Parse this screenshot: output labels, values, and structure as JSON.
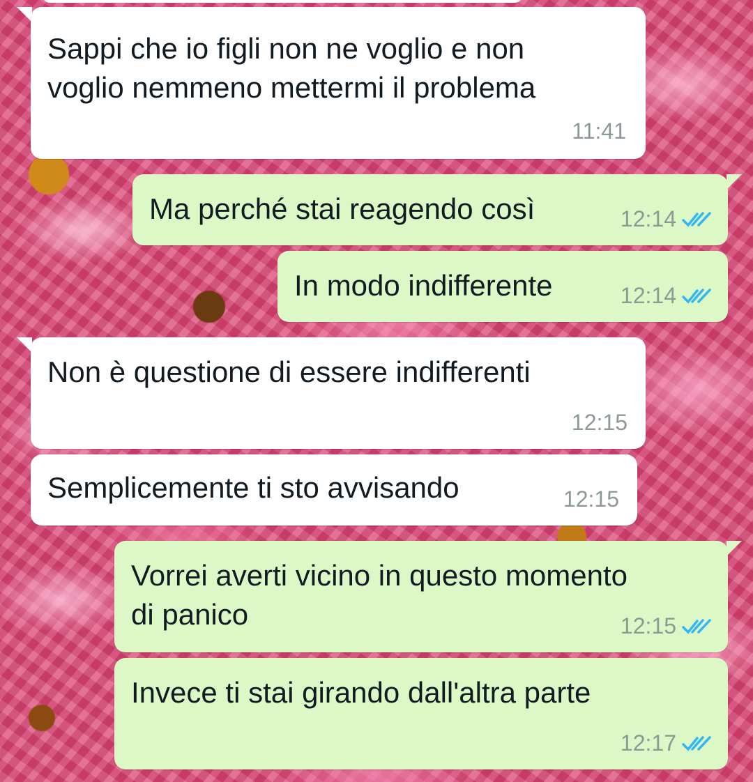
{
  "colors": {
    "incoming_bubble": "#ffffff",
    "outgoing_bubble": "#dcf8c6",
    "text": "#111b21",
    "timestamp": "#8d9a94",
    "read_ticks": "#34b7f1",
    "wallpaper": "#d94a78"
  },
  "wallpaper_description": "pink-flowers-wallpaper",
  "messages": [
    {
      "direction": "incoming",
      "lines": [
        "Sappi che io figli non ne voglio e non",
        "voglio nemmeno mettermi il problema"
      ],
      "time": "11:41"
    },
    {
      "direction": "outgoing",
      "lines": [
        "Ma perché stai reagendo così"
      ],
      "time": "12:14",
      "status_icon": "double-check-read-icon"
    },
    {
      "direction": "outgoing",
      "lines": [
        "In modo indifferente"
      ],
      "time": "12:14",
      "status_icon": "double-check-read-icon"
    },
    {
      "direction": "incoming",
      "lines": [
        "Non è questione di essere indifferenti"
      ],
      "time": "12:15"
    },
    {
      "direction": "incoming",
      "lines": [
        "Semplicemente ti sto avvisando"
      ],
      "time": "12:15"
    },
    {
      "direction": "outgoing",
      "lines": [
        "Vorrei averti vicino in questo momento",
        "di panico"
      ],
      "time": "12:15",
      "status_icon": "double-check-read-icon"
    },
    {
      "direction": "outgoing",
      "lines": [
        "Invece ti stai girando dall'altra parte"
      ],
      "time": "12:17",
      "status_icon": "double-check-read-icon"
    }
  ]
}
